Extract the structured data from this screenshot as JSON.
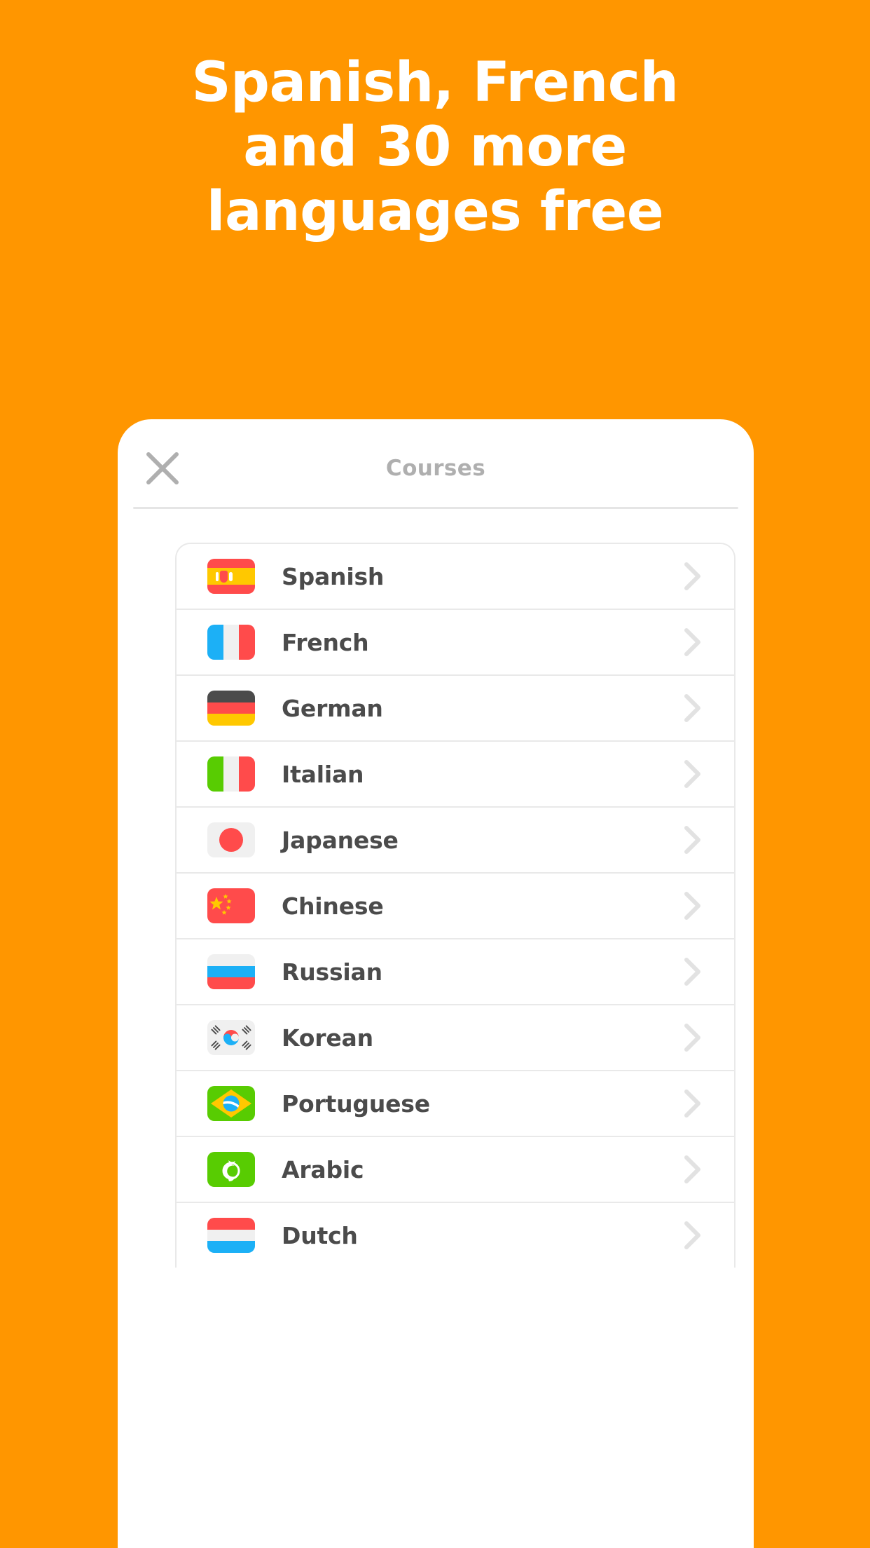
{
  "colors": {
    "background": "#FF9600",
    "card": "#FFFFFF",
    "headline_text": "#FFFFFF",
    "title_text": "#AFAFAF",
    "row_text": "#4B4B4B",
    "divider": "#E9E9E9",
    "chevron": "#E5E5E5",
    "flag_red": "#FF4B4B",
    "flag_yellow": "#FFC800",
    "flag_blue": "#1CB0F6",
    "flag_green": "#58CC02",
    "flag_white": "#F0F0F0",
    "flag_dark": "#4B4B4B"
  },
  "headline": {
    "lines": [
      "Spanish, French",
      "and 30 more",
      "languages free"
    ]
  },
  "card": {
    "header": {
      "close_icon": "close-icon",
      "title": "Courses"
    },
    "courses": [
      {
        "label": "Spanish",
        "flag": "spain-flag",
        "flag_class": "fl-es",
        "chevron": "chevron-right-icon"
      },
      {
        "label": "French",
        "flag": "france-flag",
        "flag_class": "fl-fr",
        "chevron": "chevron-right-icon"
      },
      {
        "label": "German",
        "flag": "germany-flag",
        "flag_class": "fl-de",
        "chevron": "chevron-right-icon"
      },
      {
        "label": "Italian",
        "flag": "italy-flag",
        "flag_class": "fl-it",
        "chevron": "chevron-right-icon"
      },
      {
        "label": "Japanese",
        "flag": "japan-flag",
        "flag_class": "fl-jp",
        "chevron": "chevron-right-icon"
      },
      {
        "label": "Chinese",
        "flag": "china-flag",
        "flag_class": "fl-cn",
        "chevron": "chevron-right-icon"
      },
      {
        "label": "Russian",
        "flag": "russia-flag",
        "flag_class": "fl-ru",
        "chevron": "chevron-right-icon"
      },
      {
        "label": "Korean",
        "flag": "korea-flag",
        "flag_class": "fl-kr",
        "chevron": "chevron-right-icon"
      },
      {
        "label": "Portuguese",
        "flag": "brazil-flag",
        "flag_class": "fl-br",
        "chevron": "chevron-right-icon"
      },
      {
        "label": "Arabic",
        "flag": "arabic-flag",
        "flag_class": "fl-ar",
        "chevron": "chevron-right-icon"
      },
      {
        "label": "Dutch",
        "flag": "netherlands-flag",
        "flag_class": "fl-nl",
        "chevron": "chevron-right-icon"
      }
    ]
  }
}
